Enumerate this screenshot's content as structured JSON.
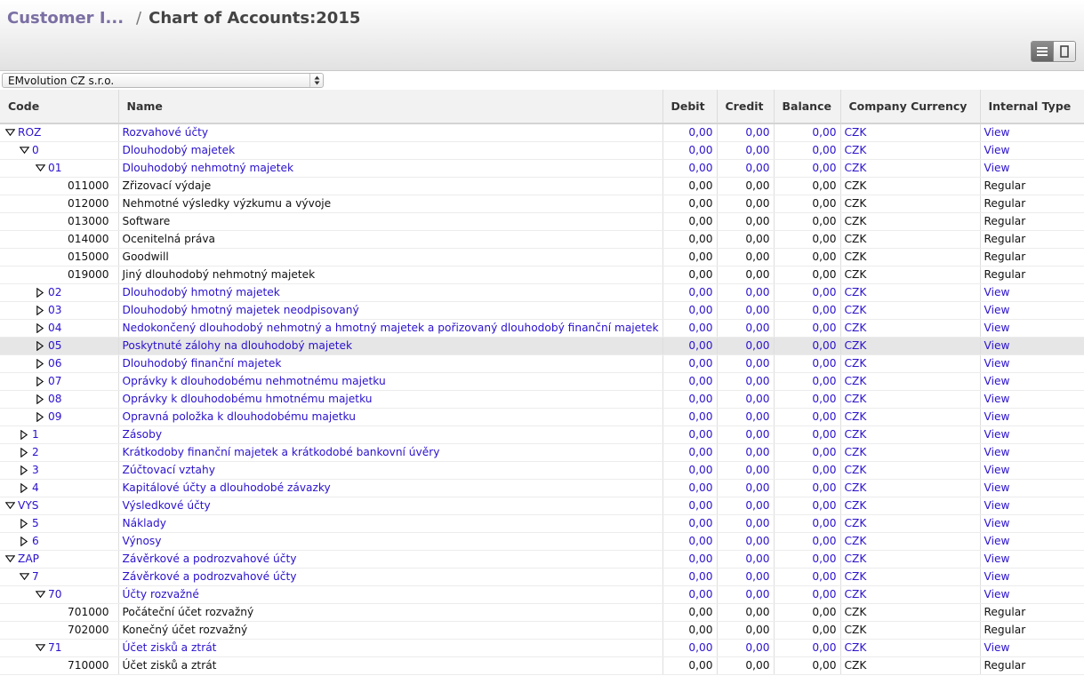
{
  "header": {
    "breadcrumb_parent": "Customer I...",
    "separator": "/",
    "title": "Chart of Accounts:2015"
  },
  "company_selector": {
    "value": "EMvolution CZ s.r.o."
  },
  "table": {
    "columns": [
      "Code",
      "Name",
      "Debit",
      "Credit",
      "Balance",
      "Company Currency",
      "Internal Type"
    ],
    "rows": [
      {
        "code": "ROZ",
        "name": "Rozvahové účty",
        "debit": "0,00",
        "credit": "0,00",
        "balance": "0,00",
        "currency": "CZK",
        "type": "View",
        "level": 0,
        "toggle": "open"
      },
      {
        "code": "0",
        "name": "Dlouhodobý majetek",
        "debit": "0,00",
        "credit": "0,00",
        "balance": "0,00",
        "currency": "CZK",
        "type": "View",
        "level": 1,
        "toggle": "open"
      },
      {
        "code": "01",
        "name": "Dlouhodobý nehmotný majetek",
        "debit": "0,00",
        "credit": "0,00",
        "balance": "0,00",
        "currency": "CZK",
        "type": "View",
        "level": 2,
        "toggle": "open"
      },
      {
        "code": "011000",
        "name": "Zřizovací výdaje",
        "debit": "0,00",
        "credit": "0,00",
        "balance": "0,00",
        "currency": "CZK",
        "type": "Regular",
        "level": 3,
        "toggle": "none"
      },
      {
        "code": "012000",
        "name": "Nehmotné výsledky výzkumu a vývoje",
        "debit": "0,00",
        "credit": "0,00",
        "balance": "0,00",
        "currency": "CZK",
        "type": "Regular",
        "level": 3,
        "toggle": "none"
      },
      {
        "code": "013000",
        "name": "Software",
        "debit": "0,00",
        "credit": "0,00",
        "balance": "0,00",
        "currency": "CZK",
        "type": "Regular",
        "level": 3,
        "toggle": "none"
      },
      {
        "code": "014000",
        "name": "Ocenitelná práva",
        "debit": "0,00",
        "credit": "0,00",
        "balance": "0,00",
        "currency": "CZK",
        "type": "Regular",
        "level": 3,
        "toggle": "none"
      },
      {
        "code": "015000",
        "name": "Goodwill",
        "debit": "0,00",
        "credit": "0,00",
        "balance": "0,00",
        "currency": "CZK",
        "type": "Regular",
        "level": 3,
        "toggle": "none"
      },
      {
        "code": "019000",
        "name": "Jiný dlouhodobý nehmotný majetek",
        "debit": "0,00",
        "credit": "0,00",
        "balance": "0,00",
        "currency": "CZK",
        "type": "Regular",
        "level": 3,
        "toggle": "none"
      },
      {
        "code": "02",
        "name": "Dlouhodobý hmotný majetek",
        "debit": "0,00",
        "credit": "0,00",
        "balance": "0,00",
        "currency": "CZK",
        "type": "View",
        "level": 2,
        "toggle": "closed"
      },
      {
        "code": "03",
        "name": "Dlouhodobý hmotný majetek neodpisovaný",
        "debit": "0,00",
        "credit": "0,00",
        "balance": "0,00",
        "currency": "CZK",
        "type": "View",
        "level": 2,
        "toggle": "closed"
      },
      {
        "code": "04",
        "name": "Nedokončený dlouhodobý nehmotný a hmotný majetek a pořizovaný dlouhodobý finanční majetek",
        "debit": "0,00",
        "credit": "0,00",
        "balance": "0,00",
        "currency": "CZK",
        "type": "View",
        "level": 2,
        "toggle": "closed"
      },
      {
        "code": "05",
        "name": "Poskytnuté zálohy na dlouhodobý majetek",
        "debit": "0,00",
        "credit": "0,00",
        "balance": "0,00",
        "currency": "CZK",
        "type": "View",
        "level": 2,
        "toggle": "closed",
        "highlight": true
      },
      {
        "code": "06",
        "name": "Dlouhodobý finanční majetek",
        "debit": "0,00",
        "credit": "0,00",
        "balance": "0,00",
        "currency": "CZK",
        "type": "View",
        "level": 2,
        "toggle": "closed"
      },
      {
        "code": "07",
        "name": "Oprávky k dlouhodobému nehmotnému majetku",
        "debit": "0,00",
        "credit": "0,00",
        "balance": "0,00",
        "currency": "CZK",
        "type": "View",
        "level": 2,
        "toggle": "closed"
      },
      {
        "code": "08",
        "name": "Oprávky k dlouhodobému hmotnému majetku",
        "debit": "0,00",
        "credit": "0,00",
        "balance": "0,00",
        "currency": "CZK",
        "type": "View",
        "level": 2,
        "toggle": "closed"
      },
      {
        "code": "09",
        "name": "Opravná položka k dlouhodobému majetku",
        "debit": "0,00",
        "credit": "0,00",
        "balance": "0,00",
        "currency": "CZK",
        "type": "View",
        "level": 2,
        "toggle": "closed"
      },
      {
        "code": "1",
        "name": "Zásoby",
        "debit": "0,00",
        "credit": "0,00",
        "balance": "0,00",
        "currency": "CZK",
        "type": "View",
        "level": 1,
        "toggle": "closed"
      },
      {
        "code": "2",
        "name": "Krátkodoby finanční majetek a krátkodobé bankovní úvěry",
        "debit": "0,00",
        "credit": "0,00",
        "balance": "0,00",
        "currency": "CZK",
        "type": "View",
        "level": 1,
        "toggle": "closed"
      },
      {
        "code": "3",
        "name": "Zúčtovací vztahy",
        "debit": "0,00",
        "credit": "0,00",
        "balance": "0,00",
        "currency": "CZK",
        "type": "View",
        "level": 1,
        "toggle": "closed"
      },
      {
        "code": "4",
        "name": "Kapitálové účty a dlouhodobé závazky",
        "debit": "0,00",
        "credit": "0,00",
        "balance": "0,00",
        "currency": "CZK",
        "type": "View",
        "level": 1,
        "toggle": "closed"
      },
      {
        "code": "VYS",
        "name": "Výsledkové účty",
        "debit": "0,00",
        "credit": "0,00",
        "balance": "0,00",
        "currency": "CZK",
        "type": "View",
        "level": 0,
        "toggle": "open"
      },
      {
        "code": "5",
        "name": "Náklady",
        "debit": "0,00",
        "credit": "0,00",
        "balance": "0,00",
        "currency": "CZK",
        "type": "View",
        "level": 1,
        "toggle": "closed"
      },
      {
        "code": "6",
        "name": "Výnosy",
        "debit": "0,00",
        "credit": "0,00",
        "balance": "0,00",
        "currency": "CZK",
        "type": "View",
        "level": 1,
        "toggle": "closed"
      },
      {
        "code": "ZAP",
        "name": "Závěrkové a podrozvahové účty",
        "debit": "0,00",
        "credit": "0,00",
        "balance": "0,00",
        "currency": "CZK",
        "type": "View",
        "level": 0,
        "toggle": "open"
      },
      {
        "code": "7",
        "name": "Závěrkové a podrozvahové účty",
        "debit": "0,00",
        "credit": "0,00",
        "balance": "0,00",
        "currency": "CZK",
        "type": "View",
        "level": 1,
        "toggle": "open"
      },
      {
        "code": "70",
        "name": "Účty rozvažné",
        "debit": "0,00",
        "credit": "0,00",
        "balance": "0,00",
        "currency": "CZK",
        "type": "View",
        "level": 2,
        "toggle": "open"
      },
      {
        "code": "701000",
        "name": "Počáteční účet rozvažný",
        "debit": "0,00",
        "credit": "0,00",
        "balance": "0,00",
        "currency": "CZK",
        "type": "Regular",
        "level": 3,
        "toggle": "none"
      },
      {
        "code": "702000",
        "name": "Konečný účet rozvažný",
        "debit": "0,00",
        "credit": "0,00",
        "balance": "0,00",
        "currency": "CZK",
        "type": "Regular",
        "level": 3,
        "toggle": "none"
      },
      {
        "code": "71",
        "name": "Účet zisků a ztrát",
        "debit": "0,00",
        "credit": "0,00",
        "balance": "0,00",
        "currency": "CZK",
        "type": "View",
        "level": 2,
        "toggle": "open"
      },
      {
        "code": "710000",
        "name": "Účet zisků a ztrát",
        "debit": "0,00",
        "credit": "0,00",
        "balance": "0,00",
        "currency": "CZK",
        "type": "Regular",
        "level": 3,
        "toggle": "none"
      }
    ]
  },
  "colors": {
    "link": "#2a12cc",
    "breadcrumb_link": "#7b6fa3",
    "highlight_row": "#e6e6e6"
  },
  "icons": {
    "list_view": "list-view-icon",
    "form_view": "form-view-icon",
    "expanded": "triangle-down-icon",
    "collapsed": "triangle-right-icon"
  }
}
